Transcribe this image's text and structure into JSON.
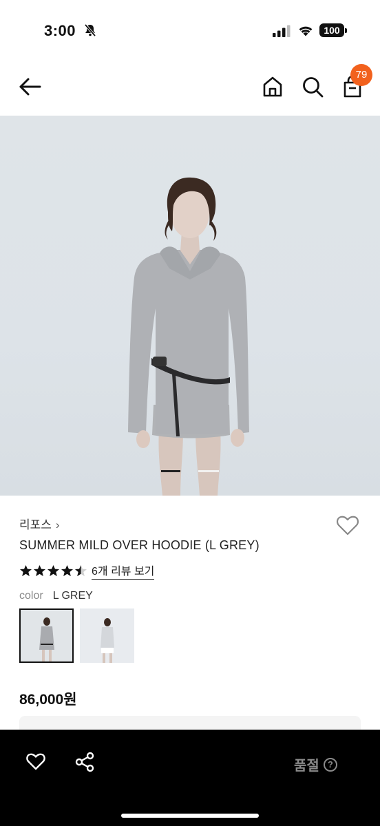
{
  "status_bar": {
    "time": "3:00",
    "battery": "100",
    "icons": [
      "bell-muted-icon",
      "signal-icon",
      "wifi-icon",
      "battery-icon"
    ]
  },
  "nav": {
    "cart_count": "79",
    "icons": [
      "arrow-left-icon",
      "home-icon",
      "search-icon",
      "shopping-bag-icon"
    ]
  },
  "product": {
    "brand": "리포스",
    "brand_chevron": "›",
    "name": "SUMMER MILD OVER HOODIE (L GREY)",
    "rating": 4.5,
    "rating_max": 5,
    "review_link": "6개 리뷰 보기",
    "color_label": "color",
    "color_value": "L GREY",
    "thumbnails": 2,
    "selected_thumbnail": 1,
    "price": "86,000원",
    "carousel_pages": 2,
    "carousel_active": 1
  },
  "bottom_bar": {
    "status": "품절",
    "help": "?",
    "icons": [
      "heart-icon",
      "share-icon",
      "help-icon"
    ]
  },
  "colors": {
    "badge": "#f2611d",
    "bottom_bar_bg": "#000000",
    "soldout_text": "#8a8a8a"
  }
}
